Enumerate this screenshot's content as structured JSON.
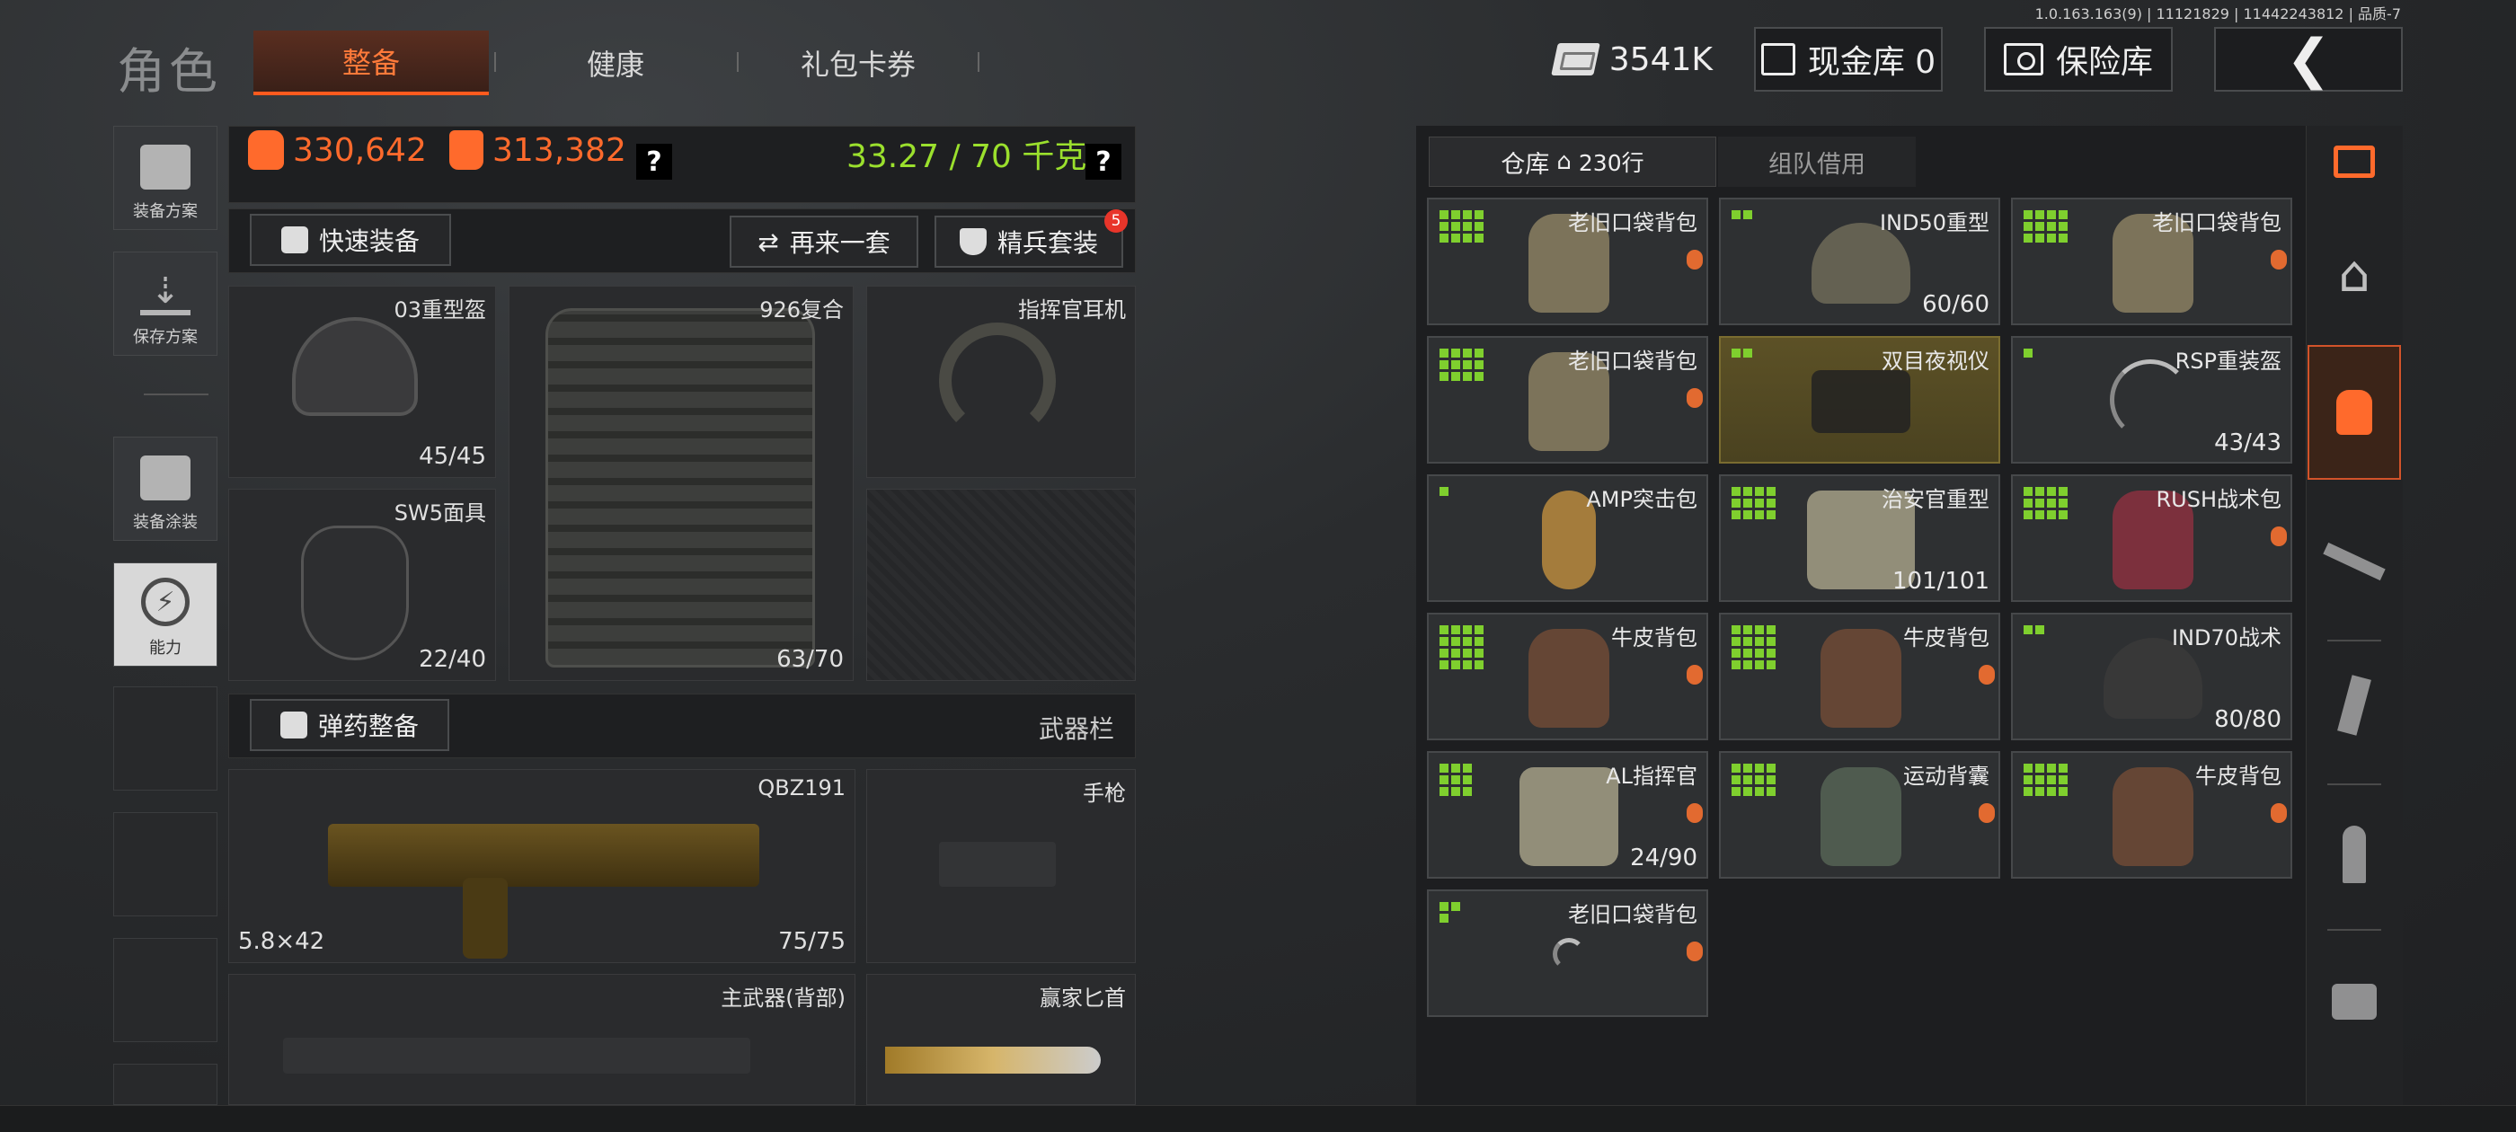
{
  "version": "1.0.163.163(9) | 11121829 | 11442243812 | 品质-7",
  "header": {
    "title": "角色",
    "tabs": [
      {
        "label": "整备",
        "active": true
      },
      {
        "label": "健康"
      },
      {
        "label": "礼包卡券"
      }
    ],
    "currency": "3541K",
    "cash_vault": "现金库 0",
    "safe": "保险库",
    "back_icon": "chevron-left-icon"
  },
  "sidebar": {
    "items": [
      {
        "label": "装备方案",
        "icon": "vest-icon"
      },
      {
        "label": "保存方案",
        "icon": "download-icon"
      },
      {
        "label": "装备涂装",
        "icon": "paint-icon"
      },
      {
        "label": "能力",
        "icon": "lightning-icon"
      }
    ]
  },
  "stats": {
    "value1": "330,642",
    "value2": "313,382",
    "weight": "33.27 / 70 千克",
    "help": "?"
  },
  "colors": {
    "accent": "#ff6a2c",
    "green": "#9be02d",
    "badge": "#e8352a"
  },
  "buttons": {
    "quick_equip": "快速装备",
    "again": "再来一套",
    "elite": "精兵套装",
    "elite_badge": "5",
    "ammo": "弹药整备"
  },
  "equip": {
    "helmet": {
      "name": "03重型盔",
      "dur": "45/45"
    },
    "armor": {
      "name": "926复合",
      "dur": "63/70"
    },
    "headset": {
      "name": "指挥官耳机"
    },
    "mask": {
      "name": "SW5面具",
      "dur": "22/40"
    },
    "weapon_bar": "武器栏",
    "primary": {
      "name": "QBZ191",
      "caliber": "5.8×42",
      "dur": "75/75"
    },
    "pistol": {
      "name": "手枪"
    },
    "back_weapon": {
      "name": "主武器(背部)"
    },
    "knife": {
      "name": "赢家匕首"
    }
  },
  "inventory": {
    "tabs": [
      {
        "label": "仓库",
        "extra": "230行"
      },
      {
        "label": "组队借用"
      }
    ],
    "items": [
      {
        "name": "老旧口袋背包",
        "dur": "",
        "grid": 12
      },
      {
        "name": "IND50重型",
        "dur": "60/60",
        "grid": 2
      },
      {
        "name": "老旧口袋背包",
        "dur": "",
        "grid": 12
      },
      {
        "name": "老旧口袋背包",
        "dur": "",
        "grid": 12
      },
      {
        "name": "双目夜视仪",
        "dur": "",
        "grid": 2
      },
      {
        "name": "RSP重装盔",
        "dur": "43/43",
        "grid": 1
      },
      {
        "name": "AMP突击包",
        "dur": "",
        "grid": 1
      },
      {
        "name": "治安官重型",
        "dur": "101/101",
        "grid": 12
      },
      {
        "name": "RUSH战术包",
        "dur": "",
        "grid": 12
      },
      {
        "name": "牛皮背包",
        "dur": "",
        "grid": 16
      },
      {
        "name": "牛皮背包",
        "dur": "",
        "grid": 16
      },
      {
        "name": "IND70战术",
        "dur": "80/80",
        "grid": 2
      },
      {
        "name": "AL指挥官",
        "dur": "24/90",
        "grid": 9
      },
      {
        "name": "运动背囊",
        "dur": "",
        "grid": 12
      },
      {
        "name": "牛皮背包",
        "dur": "",
        "grid": 12
      },
      {
        "name": "老旧口袋背包",
        "dur": "",
        "grid": 3
      }
    ]
  },
  "rail": [
    "sort-icon",
    "home-icon",
    "backpack-icon",
    "rifle-icon",
    "magazine-icon",
    "ammo-icon",
    "sight-icon"
  ]
}
